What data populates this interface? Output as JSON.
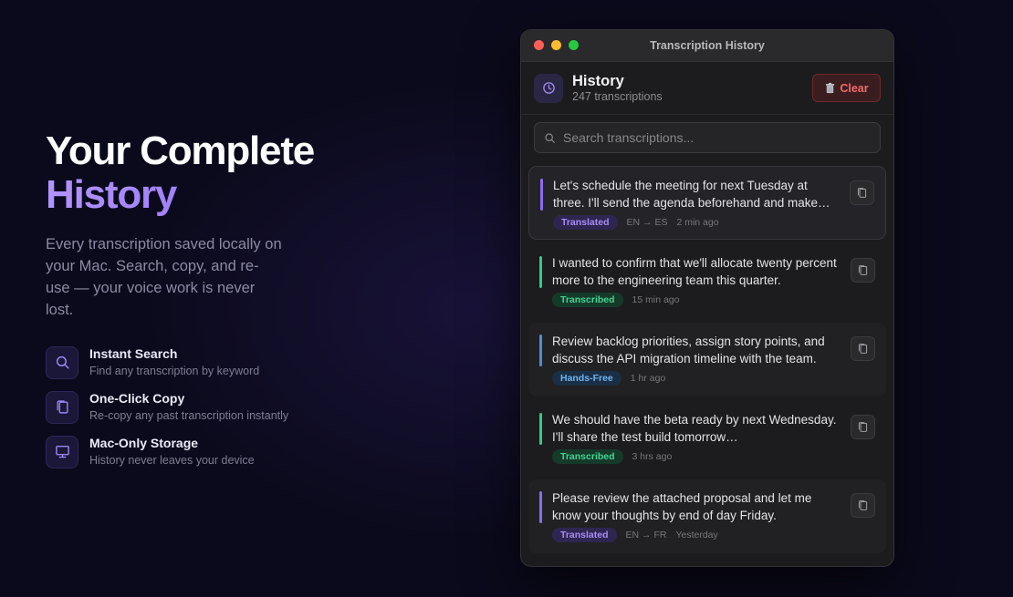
{
  "hero": {
    "headline_line1": "Your Complete",
    "headline_line2": "History",
    "lead": "Every transcription saved locally on your Mac. Search, copy, and re-use — your voice work is never lost."
  },
  "features": [
    {
      "icon": "search-icon",
      "title": "Instant Search",
      "desc": "Find any transcription by keyword"
    },
    {
      "icon": "copy-icon",
      "title": "One-Click Copy",
      "desc": "Re-copy any past transcription instantly"
    },
    {
      "icon": "monitor-icon",
      "title": "Mac-Only Storage",
      "desc": "History never leaves your device"
    }
  ],
  "window": {
    "title": "Transcription History",
    "header": {
      "title": "History",
      "subtitle": "247 transcriptions",
      "clear_label": "Clear"
    },
    "search": {
      "placeholder": "Search transcriptions...",
      "value": ""
    },
    "items": [
      {
        "text": "Let's schedule the meeting for next Tuesday at three. I'll send the agenda beforehand and make…",
        "tag": "Translated",
        "lang": "EN → ES",
        "time": "2 min ago",
        "accent": "#8b6cf0"
      },
      {
        "text": "I wanted to confirm that we'll allocate twenty percent more to the engineering team this quarter.",
        "tag": "Transcribed",
        "lang": "",
        "time": "15 min ago",
        "accent": "#35c98a"
      },
      {
        "text": "Review backlog priorities, assign story points, and discuss the API migration timeline with the team.",
        "tag": "Hands-Free",
        "lang": "",
        "time": "1 hr ago",
        "accent": "#4a8fd6"
      },
      {
        "text": "We should have the beta ready by next Wednesday. I'll share the test build tomorrow…",
        "tag": "Transcribed",
        "lang": "",
        "time": "3 hrs ago",
        "accent": "#35c98a"
      },
      {
        "text": "Please review the attached proposal and let me know your thoughts by end of day Friday.",
        "tag": "Translated",
        "lang": "EN → FR",
        "time": "Yesterday",
        "accent": "#8b6cf0"
      }
    ]
  },
  "colors": {
    "accent_purple": "#9a7cf6",
    "clear_red": "#f06a6a",
    "window_bg": "#1c1c1e",
    "page_bg": "#0b0a1c"
  }
}
